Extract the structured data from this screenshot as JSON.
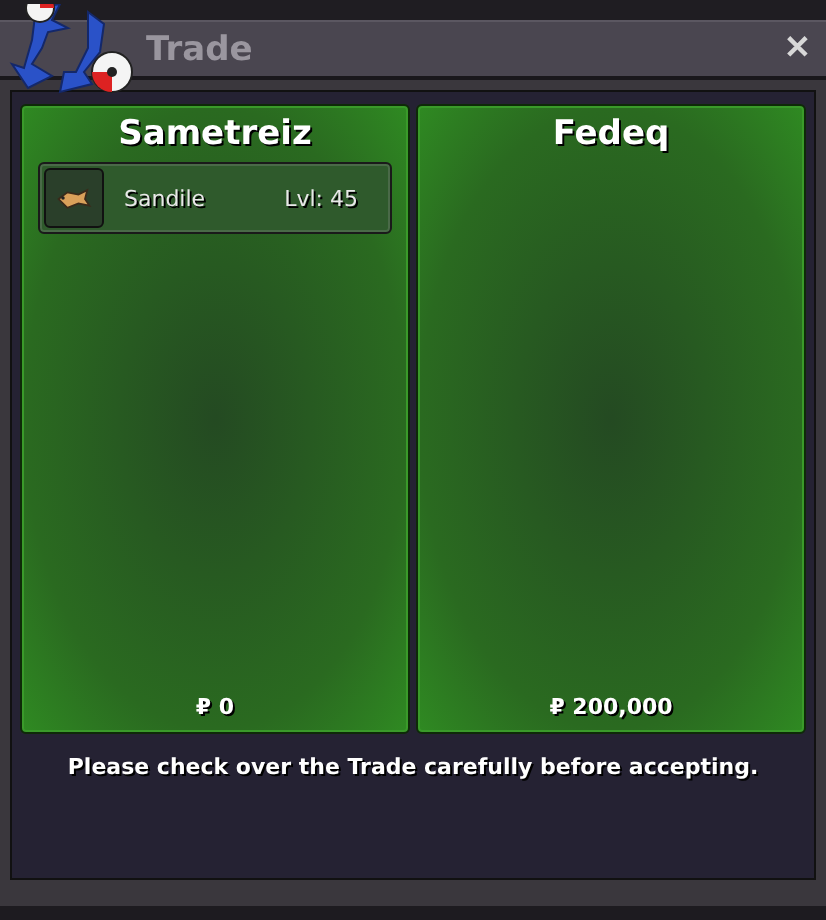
{
  "window": {
    "title": "Trade",
    "close": "✕"
  },
  "parties": [
    {
      "name": "Sametreiz",
      "items": [
        {
          "name": "Sandile",
          "level": "Lvl: 45"
        }
      ],
      "money": "₽ 0"
    },
    {
      "name": "Fedeq",
      "money": "₽ 200,000"
    }
  ],
  "message": "Please check over the Trade carefully before accepting."
}
